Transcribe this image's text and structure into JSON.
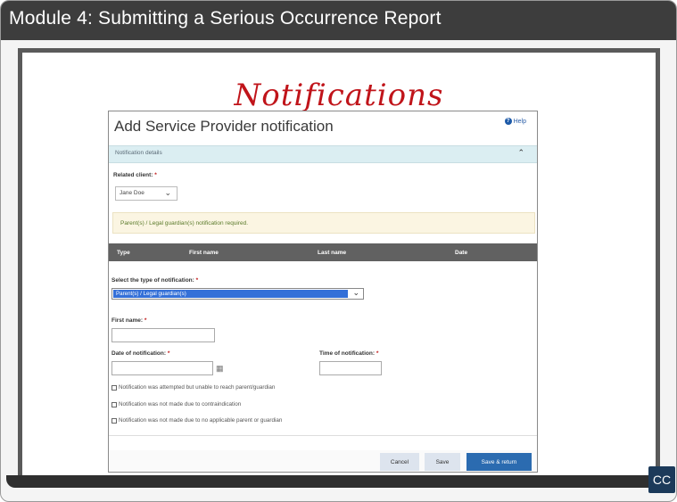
{
  "module_title": "Module 4:  Submitting a Serious Occurrence Report",
  "slide_heading": "Notifications",
  "cc_label": "CC",
  "colors": {
    "title_bar": "#3d3d3d",
    "slide_heading": "#c0141a",
    "primary_button": "#2b6bb0",
    "selected_option": "#3470d8",
    "section_bar": "#dbeef2",
    "notice_bg": "#fbf5e2",
    "table_header": "#616161"
  },
  "form": {
    "title": "Add Service Provider notification",
    "help_label": "Help",
    "section_label": "Notification details",
    "related_client_label": "Related client:",
    "related_client_value": "Jane Doe",
    "notice_text": "Parent(s) / Legal guardian(s) notification required.",
    "table_columns": [
      "Type",
      "First name",
      "Last name",
      "Date"
    ],
    "select_type_label": "Select the type of notification:",
    "select_type_value": "Parent(s) / Legal guardian(s)",
    "first_name_label": "First name:",
    "first_name_value": "",
    "date_label": "Date of notification:",
    "date_value": "",
    "time_label": "Time of notification:",
    "time_value": "",
    "required_mark": "*",
    "checkboxes": [
      {
        "label": "Notification was attempted but unable to reach parent/guardian",
        "checked": false
      },
      {
        "label": "Notification was not made due to contraindication",
        "checked": false
      },
      {
        "label": "Notification was not made due to no applicable parent or guardian",
        "checked": false
      }
    ],
    "buttons": {
      "cancel": "Cancel",
      "save": "Save",
      "save_return": "Save & return"
    }
  }
}
